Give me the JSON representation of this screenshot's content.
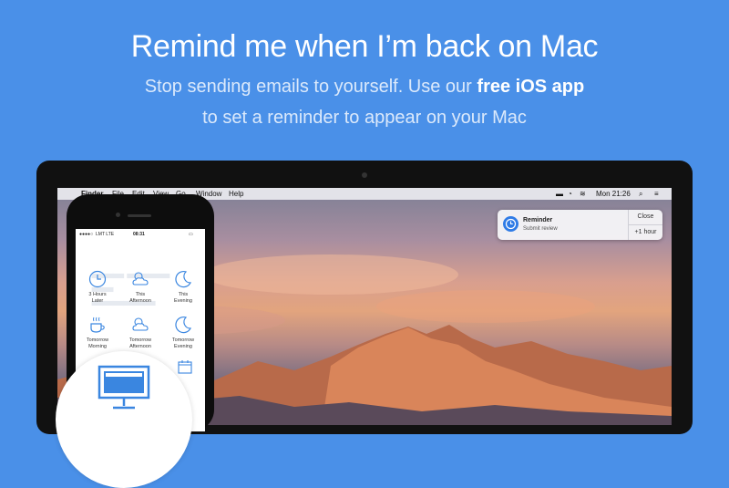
{
  "hero": {
    "headline": "Remind me when I’m back on Mac",
    "subline_1_plain": "Stop sending emails to yourself. Use our ",
    "subline_1_bold": "free iOS app",
    "subline_2": "to set a reminder to appear on your Mac"
  },
  "menubar": {
    "items": [
      "Finder",
      "File",
      "Edit",
      "View",
      "Go",
      "Window",
      "Help"
    ],
    "clock": "Mon 21:26"
  },
  "notification": {
    "title": "Reminder",
    "body": "Submit review",
    "close_label": "Close",
    "snooze_label": "+1 hour"
  },
  "phone": {
    "status": {
      "carrier": "LMT  LTE",
      "time": "08:31"
    },
    "tiles": [
      {
        "label_1": "3 Hours",
        "label_2": "Later",
        "icon": "clock-icon"
      },
      {
        "label_1": "This",
        "label_2": "Afternoon",
        "icon": "cloud-sun-icon"
      },
      {
        "label_1": "This",
        "label_2": "Evening",
        "icon": "moon-icon"
      },
      {
        "label_1": "Tomorrow",
        "label_2": "Morning",
        "icon": "coffee-icon"
      },
      {
        "label_1": "Tomorrow",
        "label_2": "Afternoon",
        "icon": "cloud-sun-icon"
      },
      {
        "label_1": "Tomorrow",
        "label_2": "Evening",
        "icon": "moon-icon"
      }
    ]
  },
  "colors": {
    "background": "#4a90e8",
    "accent": "#2f7be6",
    "icon_blue": "#3a86e0"
  }
}
